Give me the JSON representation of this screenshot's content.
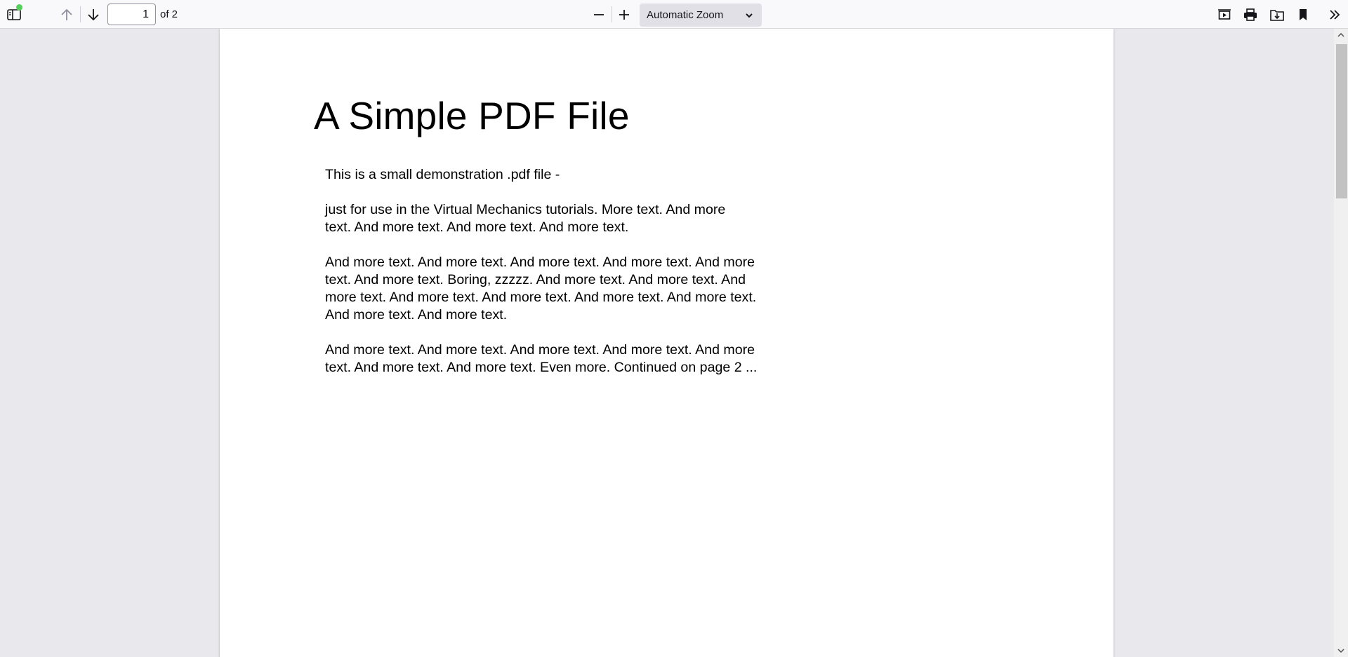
{
  "toolbar": {
    "page_number": "1",
    "page_count_text": "of 2",
    "zoom_label": "Automatic Zoom",
    "icons": {
      "sidebar": "sidebar-toggle-icon",
      "previous": "arrow-up-icon",
      "next": "arrow-down-icon",
      "zoom_out": "minus-icon",
      "zoom_in": "plus-icon",
      "presentation": "presentation-mode-icon",
      "print": "printer-icon",
      "save": "download-icon",
      "bookmark": "bookmark-icon",
      "tools": "double-chevron-right-icon"
    }
  },
  "document": {
    "title": "A Simple PDF File",
    "paragraphs": [
      [
        "This is a small demonstration .pdf file -"
      ],
      [
        "just for use in the Virtual Mechanics tutorials. More text. And more",
        "text. And more text. And more text. And more text."
      ],
      [
        "And more text. And more text. And more text. And more text. And more",
        "text. And more text. Boring, zzzzz. And more text. And more text. And",
        "more text. And more text. And more text. And more text. And more text.",
        "And more text. And more text."
      ],
      [
        "And more text. And more text. And more text. And more text. And more",
        "text. And more text. And more text. Even more. Continued on page 2 ..."
      ]
    ]
  },
  "colors": {
    "toolbar_bg": "#f9f9fb",
    "viewer_bg": "#e9e9ed",
    "page_bg": "#ffffff",
    "notification_dot": "#54d15a"
  }
}
